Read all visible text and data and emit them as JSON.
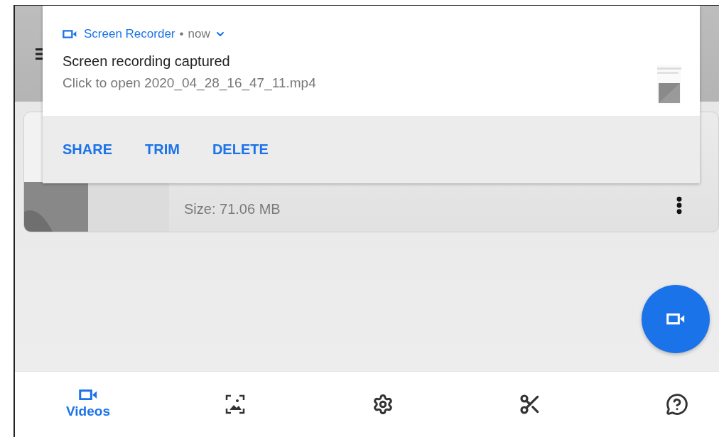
{
  "notification": {
    "app_name": "Screen Recorder",
    "separator": "•",
    "time": "now",
    "title": "Screen recording captured",
    "text": "Click to open 2020_04_28_16_47_11.mp4",
    "actions": [
      "SHARE",
      "TRIM",
      "DELETE"
    ]
  },
  "video_list": [
    {
      "size": "Size: 71.06 MB"
    }
  ],
  "bottom_nav": [
    {
      "kind": "video",
      "label": "Videos",
      "selected": true
    },
    {
      "kind": "gallery",
      "selected": false
    },
    {
      "kind": "settings",
      "selected": false
    },
    {
      "kind": "scissors",
      "selected": false
    },
    {
      "kind": "help",
      "selected": false
    }
  ]
}
